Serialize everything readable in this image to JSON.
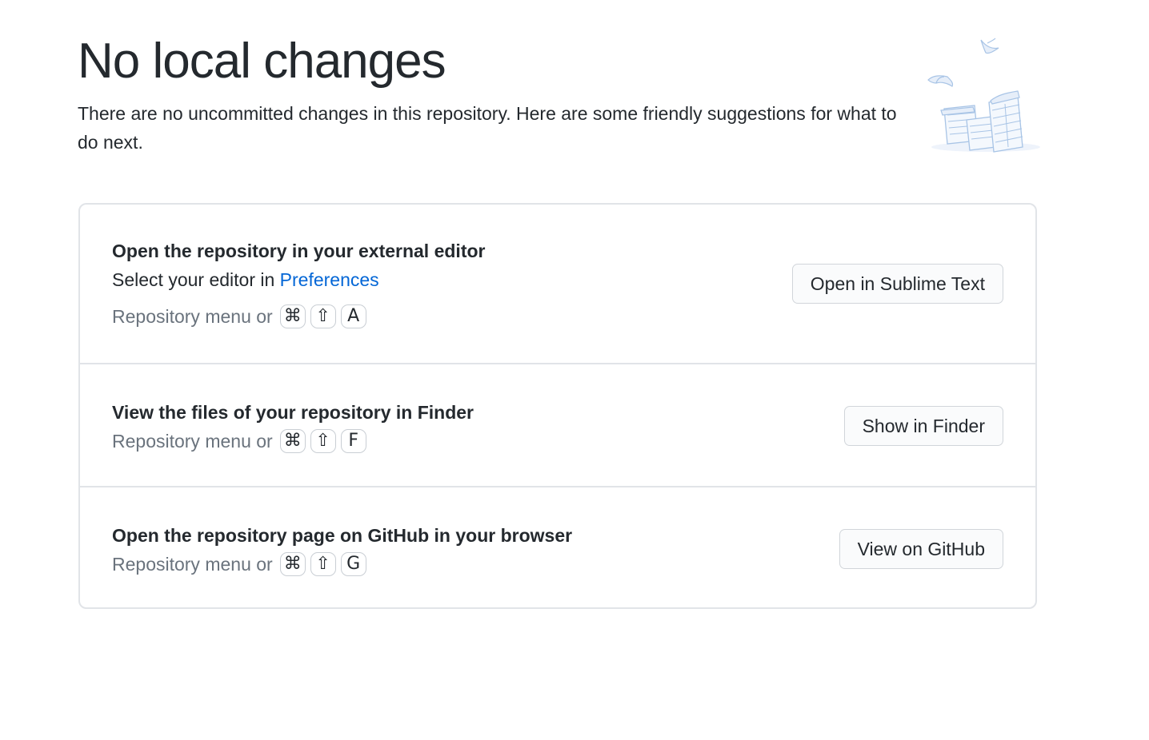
{
  "header": {
    "title": "No local changes",
    "subtitle": "There are no uncommitted changes in this repository. Here are some friendly suggestions for what to do next."
  },
  "illustration": {
    "icon": "paper-stacks-illustration",
    "color": "#a8c4e6"
  },
  "suggestions": [
    {
      "title": "Open the repository in your external editor",
      "description_prefix": "Select your editor in ",
      "description_link": "Preferences",
      "shortcut_prefix": "Repository menu or",
      "keys": [
        "⌘",
        "⇧",
        "A"
      ],
      "button_label": "Open in Sublime Text"
    },
    {
      "title": "View the files of your repository in Finder",
      "shortcut_prefix": "Repository menu or",
      "keys": [
        "⌘",
        "⇧",
        "F"
      ],
      "button_label": "Show in Finder"
    },
    {
      "title": "Open the repository page on GitHub in your browser",
      "shortcut_prefix": "Repository menu or",
      "keys": [
        "⌘",
        "⇧",
        "G"
      ],
      "button_label": "View on GitHub"
    }
  ],
  "colors": {
    "text": "#24292e",
    "muted": "#6a737d",
    "link": "#0366d6",
    "border": "#e1e4e8",
    "button_bg": "#fafbfc"
  }
}
